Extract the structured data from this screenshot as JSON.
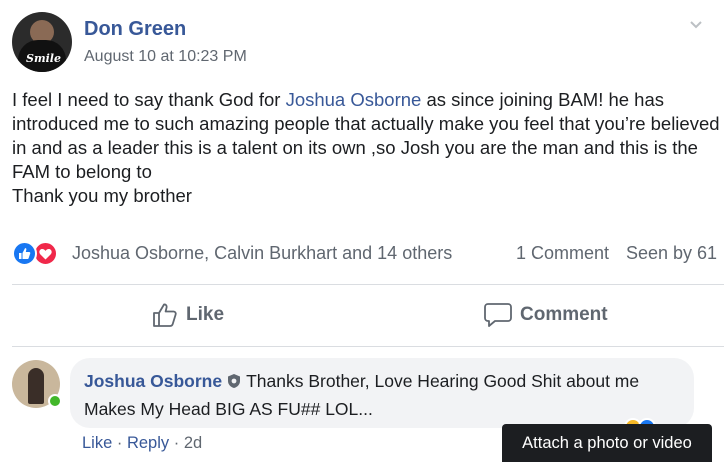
{
  "post": {
    "author": "Don Green",
    "timestamp": "August 10 at 10:23 PM",
    "avatar_shirt_text": "Smile",
    "body": {
      "part1": "I feel I need to say thank God for ",
      "mention": "Joshua Osborne",
      "part2": " as since joining BAM! he has introduced me to such amazing people that actually make you feel that you’re believed in and as a leader this is a talent on its own ,so Josh you are the man and this is the FAM to belong to",
      "line_last": "Thank you my brother"
    }
  },
  "reactions": {
    "icons": [
      "like-icon",
      "love-icon"
    ],
    "reactors": "Joshua Osborne, Calvin Burkhart and 14 others",
    "comment_count": "1 Comment",
    "seen_by": "Seen by 61"
  },
  "actions": {
    "like_label": "Like",
    "comment_label": "Comment"
  },
  "comment": {
    "author": "Joshua Osborne",
    "text": "Thanks Brother, Love Hearing Good Shit about me Makes My Head BIG AS FU## LOL...",
    "like_label": "Like",
    "reply_label": "Reply",
    "separator": "·",
    "time": "2d"
  },
  "tooltip": {
    "text": "Attach a photo or video"
  },
  "colors": {
    "link_blue": "#385898",
    "like_blue": "#1877f2",
    "love_red": "#f0284a",
    "secondary_text": "#606770",
    "bubble_bg": "#f2f3f5",
    "online_green": "#42b72a"
  }
}
